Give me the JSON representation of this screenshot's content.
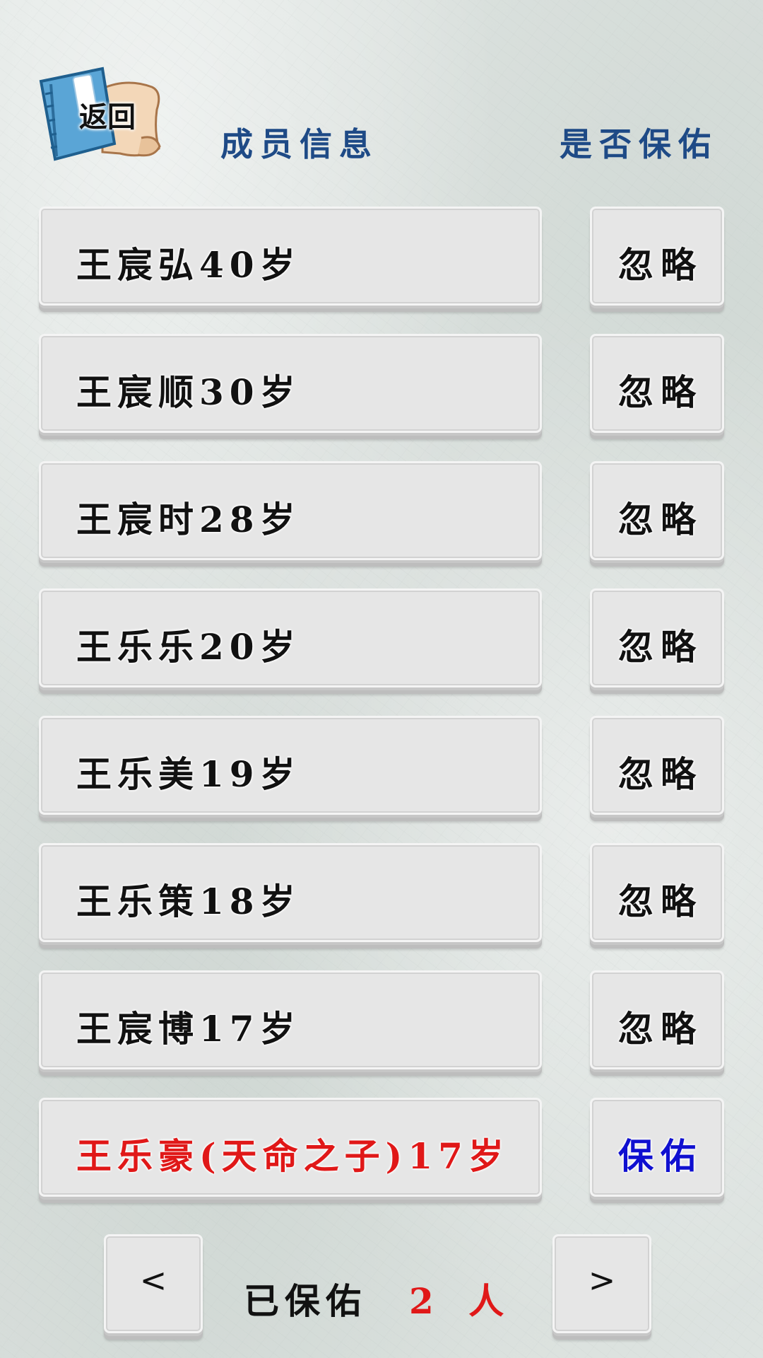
{
  "header": {
    "back_label": "返回",
    "members_title": "成员信息",
    "protect_title": "是否保佑"
  },
  "members": [
    {
      "name": "王宸弘40岁",
      "action": "忽略",
      "special": false
    },
    {
      "name": "王宸顺30岁",
      "action": "忽略",
      "special": false
    },
    {
      "name": "王宸时28岁",
      "action": "忽略",
      "special": false
    },
    {
      "name": "王乐乐20岁",
      "action": "忽略",
      "special": false
    },
    {
      "name": "王乐美19岁",
      "action": "忽略",
      "special": false
    },
    {
      "name": "王乐策18岁",
      "action": "忽略",
      "special": false
    },
    {
      "name": "王宸博17岁",
      "action": "忽略",
      "special": false
    },
    {
      "name": "王乐豪(天命之子)17岁",
      "action": "保佑",
      "special": true
    }
  ],
  "footer": {
    "prev_label": "<",
    "next_label": ">",
    "status_label": "已保佑",
    "status_count": "2 人"
  },
  "colors": {
    "header_text": "#1e4a86",
    "special_name": "#e01818",
    "protect_action": "#1010d0",
    "count": "#e01818"
  },
  "icons": {
    "back": "book-icon"
  }
}
